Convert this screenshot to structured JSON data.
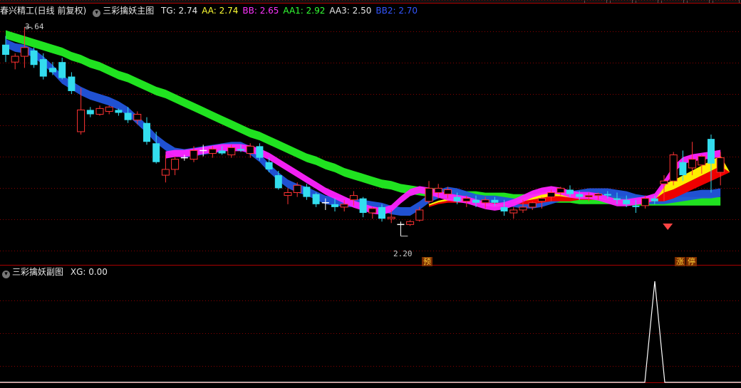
{
  "main_header": {
    "title": "春兴精工(日线 前复权)",
    "indicator_name": "三彩擒妖主图",
    "values": [
      {
        "label": "TG: 2.74",
        "color": "#e6e6e6"
      },
      {
        "label": "AA: 2.74",
        "color": "#ffff33"
      },
      {
        "label": "BB: 2.65",
        "color": "#ff33ff"
      },
      {
        "label": "AA1: 2.92",
        "color": "#33ff33"
      },
      {
        "label": "AA3: 2.50",
        "color": "#e6e6e6"
      },
      {
        "label": "BB2: 2.70",
        "color": "#3355ff"
      }
    ]
  },
  "sub_header": {
    "indicator_name": "三彩擒妖副图",
    "values": [
      {
        "label": "XG: 0.00",
        "color": "#e6e6e6"
      }
    ]
  },
  "labels": {
    "high_price": "3.64",
    "low_price": "2.20",
    "signal_yu": "预",
    "signal_zhang": "涨",
    "signal_ting": "停"
  },
  "colors": {
    "bull": "#ff3333",
    "bear": "#33ddee",
    "doji": "#ffffff",
    "grid": "#8b0000",
    "green_band": "#22ee22",
    "blue_band": "#2255dd",
    "magenta_band": "#ff22ff",
    "red_band": "#ee0000",
    "yellow_band": "#ffee00"
  },
  "chart_data": [
    {
      "type": "candlestick",
      "title": "三彩擒妖主图",
      "ylim": [
        2.1,
        3.72
      ],
      "high_marker": 3.64,
      "low_marker": 2.2,
      "candles": [
        [
          3.52,
          3.58,
          3.4,
          3.45
        ],
        [
          3.4,
          3.46,
          3.35,
          3.44
        ],
        [
          3.44,
          3.64,
          3.36,
          3.5
        ],
        [
          3.48,
          3.5,
          3.36,
          3.38
        ],
        [
          3.42,
          3.46,
          3.28,
          3.3
        ],
        [
          3.36,
          3.4,
          3.31,
          3.33
        ],
        [
          3.4,
          3.43,
          3.28,
          3.29
        ],
        [
          3.3,
          3.33,
          3.18,
          3.2
        ],
        [
          2.92,
          3.22,
          2.9,
          3.07
        ],
        [
          3.07,
          3.09,
          3.02,
          3.04
        ],
        [
          3.04,
          3.1,
          3.03,
          3.08
        ],
        [
          3.06,
          3.1,
          3.04,
          3.09
        ],
        [
          3.07,
          3.08,
          3.03,
          3.05
        ],
        [
          3.05,
          3.09,
          2.98,
          3.0
        ],
        [
          3.0,
          3.06,
          2.97,
          3.04
        ],
        [
          2.98,
          3.02,
          2.83,
          2.85
        ],
        [
          2.84,
          2.92,
          2.7,
          2.71
        ],
        [
          2.62,
          2.76,
          2.57,
          2.66
        ],
        [
          2.66,
          2.75,
          2.62,
          2.73
        ],
        [
          2.74,
          2.76,
          2.72,
          2.74
        ],
        [
          2.73,
          2.82,
          2.71,
          2.79
        ],
        [
          2.79,
          2.83,
          2.75,
          2.79
        ],
        [
          2.77,
          2.82,
          2.74,
          2.8
        ],
        [
          2.79,
          2.82,
          2.76,
          2.77
        ],
        [
          2.76,
          2.83,
          2.74,
          2.81
        ],
        [
          2.8,
          2.83,
          2.78,
          2.79
        ],
        [
          2.77,
          2.84,
          2.74,
          2.82
        ],
        [
          2.82,
          2.84,
          2.72,
          2.74
        ],
        [
          2.71,
          2.74,
          2.64,
          2.66
        ],
        [
          2.62,
          2.65,
          2.52,
          2.53
        ],
        [
          2.48,
          2.53,
          2.42,
          2.5
        ],
        [
          2.5,
          2.57,
          2.47,
          2.55
        ],
        [
          2.54,
          2.56,
          2.45,
          2.47
        ],
        [
          2.49,
          2.5,
          2.4,
          2.42
        ],
        [
          2.43,
          2.46,
          2.38,
          2.43
        ],
        [
          2.42,
          2.46,
          2.37,
          2.4
        ],
        [
          2.4,
          2.45,
          2.37,
          2.42
        ],
        [
          2.45,
          2.51,
          2.41,
          2.48
        ],
        [
          2.46,
          2.47,
          2.33,
          2.36
        ],
        [
          2.36,
          2.4,
          2.32,
          2.39
        ],
        [
          2.4,
          2.42,
          2.3,
          2.32
        ],
        [
          2.32,
          2.38,
          2.29,
          2.33
        ],
        [
          2.28,
          2.3,
          2.2,
          2.28
        ],
        [
          2.28,
          2.31,
          2.27,
          2.3
        ],
        [
          2.31,
          2.4,
          2.3,
          2.38
        ],
        [
          2.44,
          2.58,
          2.42,
          2.53
        ],
        [
          2.5,
          2.56,
          2.46,
          2.53
        ],
        [
          2.49,
          2.54,
          2.46,
          2.52
        ],
        [
          2.47,
          2.5,
          2.42,
          2.44
        ],
        [
          2.44,
          2.48,
          2.4,
          2.46
        ],
        [
          2.45,
          2.48,
          2.4,
          2.43
        ],
        [
          2.43,
          2.47,
          2.39,
          2.45
        ],
        [
          2.45,
          2.47,
          2.41,
          2.43
        ],
        [
          2.4,
          2.45,
          2.34,
          2.37
        ],
        [
          2.36,
          2.4,
          2.32,
          2.38
        ],
        [
          2.38,
          2.45,
          2.36,
          2.4
        ],
        [
          2.4,
          2.44,
          2.38,
          2.43
        ],
        [
          2.44,
          2.47,
          2.39,
          2.46
        ],
        [
          2.47,
          2.52,
          2.44,
          2.5
        ],
        [
          2.5,
          2.54,
          2.48,
          2.53
        ],
        [
          2.52,
          2.55,
          2.47,
          2.49
        ],
        [
          2.49,
          2.51,
          2.45,
          2.47
        ],
        [
          2.47,
          2.5,
          2.44,
          2.48
        ],
        [
          2.48,
          2.5,
          2.45,
          2.49
        ],
        [
          2.49,
          2.51,
          2.46,
          2.48
        ],
        [
          2.46,
          2.5,
          2.42,
          2.45
        ],
        [
          2.45,
          2.48,
          2.4,
          2.42
        ],
        [
          2.41,
          2.45,
          2.36,
          2.4
        ],
        [
          2.41,
          2.48,
          2.39,
          2.46
        ],
        [
          2.46,
          2.48,
          2.42,
          2.44
        ],
        [
          2.56,
          2.62,
          2.44,
          2.58
        ],
        [
          2.58,
          2.78,
          2.55,
          2.76
        ],
        [
          2.71,
          2.79,
          2.58,
          2.62
        ],
        [
          2.67,
          2.85,
          2.62,
          2.73
        ],
        [
          2.69,
          2.76,
          2.63,
          2.75
        ],
        [
          2.87,
          2.9,
          2.5,
          2.7
        ],
        [
          2.64,
          2.78,
          2.55,
          2.74
        ]
      ],
      "bands": [
        {
          "name": "green",
          "color": "#22ee22",
          "values": [
            3.59,
            3.57,
            3.55,
            3.53,
            3.51,
            3.49,
            3.47,
            3.44,
            3.42,
            3.39,
            3.37,
            3.34,
            3.31,
            3.29,
            3.26,
            3.23,
            3.2,
            3.18,
            3.15,
            3.12,
            3.09,
            3.06,
            3.03,
            3.0,
            2.97,
            2.94,
            2.91,
            2.89,
            2.86,
            2.83,
            2.8,
            2.77,
            2.74,
            2.72,
            2.69,
            2.67,
            2.64,
            2.62,
            2.6,
            2.58,
            2.56,
            2.55,
            2.53,
            2.52,
            2.51,
            2.5,
            2.5,
            2.49,
            2.49,
            2.48,
            2.48,
            2.47,
            2.47,
            2.47,
            2.46,
            2.46,
            2.46,
            2.46,
            2.46,
            2.46,
            2.46,
            2.45,
            2.45,
            2.45,
            2.45,
            2.45,
            2.44,
            2.44,
            2.44,
            2.44,
            2.44,
            2.44,
            2.44,
            2.44,
            2.44,
            2.44,
            2.44
          ]
        },
        {
          "name": "blue",
          "color": "#2255dd",
          "values": [
            3.53,
            3.5,
            3.49,
            3.46,
            3.41,
            3.35,
            3.28,
            3.24,
            3.2,
            3.17,
            3.15,
            3.13,
            3.1,
            3.06,
            3.0,
            2.94,
            2.87,
            2.82,
            2.78,
            2.77,
            2.78,
            2.79,
            2.8,
            2.81,
            2.82,
            2.82,
            2.79,
            2.74,
            2.67,
            2.61,
            2.56,
            2.53,
            2.51,
            2.48,
            2.45,
            2.44,
            2.43,
            2.43,
            2.42,
            2.41,
            2.4,
            2.38,
            2.37,
            2.37,
            2.41,
            2.46,
            2.49,
            2.51,
            2.5,
            2.48,
            2.46,
            2.45,
            2.45,
            2.44,
            2.43,
            2.42,
            2.42,
            2.43,
            2.45,
            2.47,
            2.48,
            2.49,
            2.5,
            2.5,
            2.5,
            2.49,
            2.48,
            2.46,
            2.45,
            2.45,
            2.45,
            2.46,
            2.47,
            2.48,
            2.49,
            2.49,
            2.5
          ]
        },
        {
          "name": "magenta",
          "color": "#ff22ff",
          "start": 17,
          "values": [
            2.76,
            2.77,
            2.77,
            2.78,
            2.79,
            2.8,
            2.81,
            2.81,
            2.81,
            2.8,
            2.78,
            2.75,
            2.71,
            2.67,
            2.63,
            2.59,
            2.55,
            2.51,
            2.48,
            2.45,
            2.42,
            2.4,
            2.38,
            2.37,
            2.39,
            2.45,
            2.5,
            2.52,
            2.51,
            2.49,
            2.47,
            2.46,
            2.45,
            2.43,
            2.41,
            2.4,
            2.41,
            2.43,
            2.46,
            2.49,
            2.51,
            2.52,
            2.51,
            2.49,
            2.48,
            2.48,
            2.47,
            2.45,
            2.43,
            2.43,
            2.44,
            2.45,
            2.47,
            2.56,
            2.66,
            2.72,
            2.74,
            2.75,
            2.76,
            2.77
          ]
        },
        {
          "name": "red",
          "color": "#ee0000",
          "start": 45,
          "values": [
            2.4,
            2.42,
            2.43,
            2.43,
            2.43,
            2.43,
            2.43,
            2.43,
            2.43,
            2.42,
            2.42,
            2.42,
            2.43,
            2.44,
            2.44,
            2.44,
            2.45,
            2.45,
            2.45,
            2.44,
            2.44,
            2.43,
            2.43,
            2.43,
            2.44,
            2.44,
            2.46,
            2.49,
            2.52,
            2.55,
            2.58,
            2.61,
            2.64
          ]
        }
      ]
    },
    {
      "type": "line",
      "title": "三彩擒妖副图",
      "series": [
        {
          "name": "XG",
          "signal_index": 70,
          "peak": 1,
          "baseline": 0
        }
      ]
    }
  ]
}
